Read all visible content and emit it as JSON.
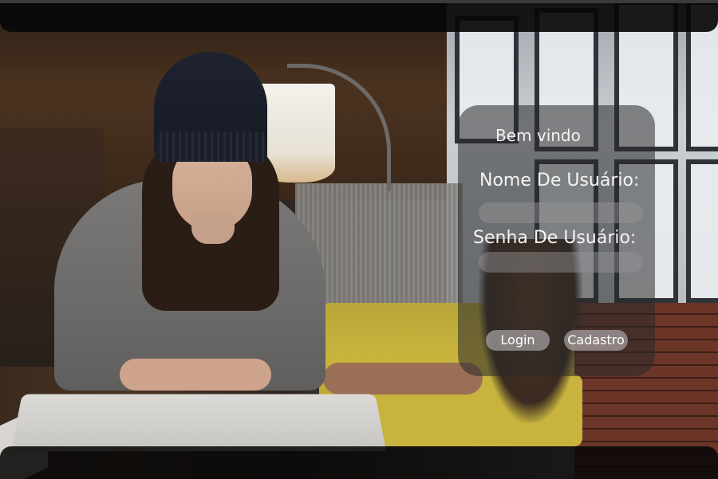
{
  "login": {
    "welcome": "Bem vindo",
    "username_label": "Nome De Usuário:",
    "username_value": "",
    "password_label": "Senha De Usuário:",
    "password_value": "",
    "login_button": "Login",
    "register_button": "Cadastro"
  },
  "background": {
    "apple_logo_glyph": ""
  }
}
